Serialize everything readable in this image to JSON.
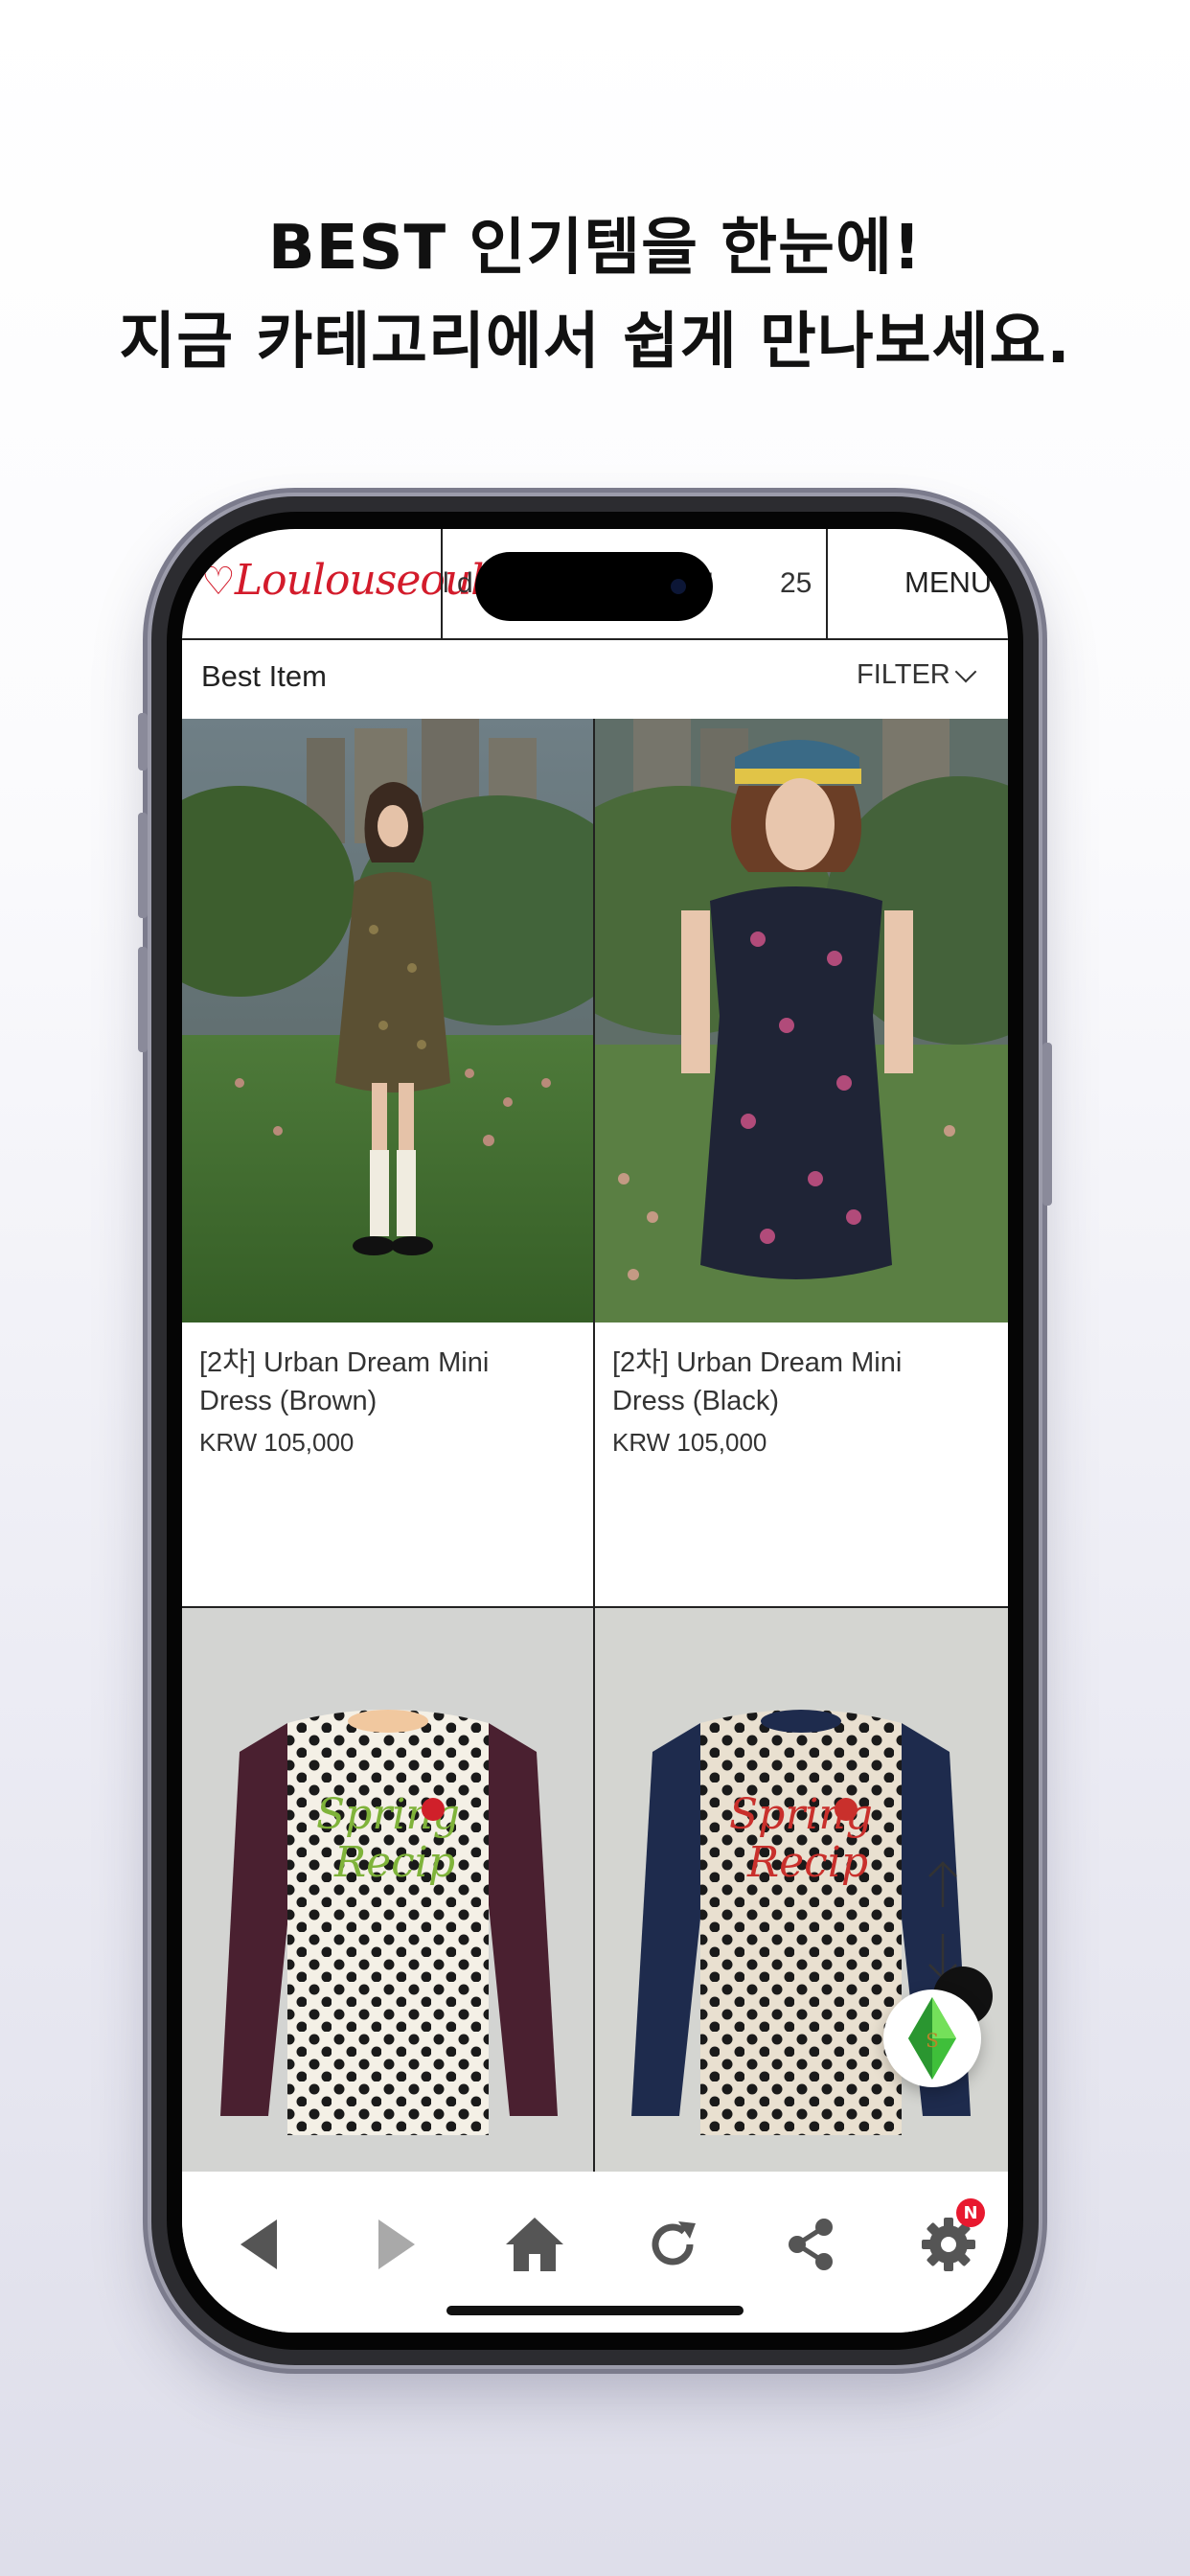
{
  "headline": {
    "line1": "BEST 인기템을 한눈에!",
    "line2": "지금 카테고리에서 쉽게 만나보세요."
  },
  "topbar": {
    "logo": "Loulouseoul",
    "ticker_left": "l d",
    "ticker_mid": "M!",
    "ticker_right": "25",
    "menu_label": "MENU"
  },
  "section": {
    "title": "Best Item",
    "filter_label": "FILTER"
  },
  "products": [
    {
      "name_line1": "[2차] Urban Dream Mini",
      "name_line2": "Dress (Brown)",
      "price": "KRW 105,000"
    },
    {
      "name_line1": "[2차] Urban Dream Mini",
      "name_line2": "Dress (Black)",
      "price": "KRW 105,000"
    },
    {
      "shirt_text": "Spring Recip",
      "sleeve_color": "#4a2030",
      "text_color": "#7fb33a"
    },
    {
      "shirt_text": "Spring Recip",
      "sleeve_color": "#1e2b4d",
      "text_color": "#c9302c"
    }
  ],
  "bottom_nav": {
    "items": [
      "back-icon",
      "forward-icon",
      "home-icon",
      "refresh-icon",
      "share-icon",
      "settings-icon"
    ],
    "settings_badge": "N"
  },
  "colors": {
    "brand_red": "#d31b2b",
    "nav_icon": "#555555",
    "badge_red": "#e8192f"
  }
}
